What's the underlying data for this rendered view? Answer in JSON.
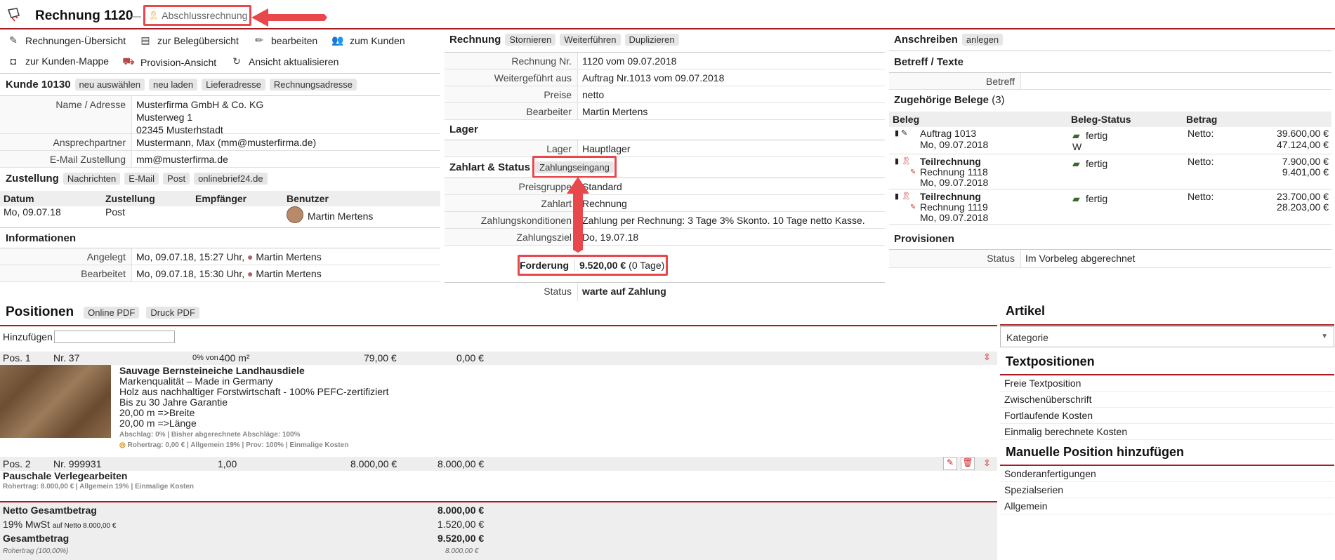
{
  "header": {
    "title": "Rechnung 1120",
    "separator": "—",
    "type_badge": "Abschlussrechnung"
  },
  "toolbar": {
    "items": [
      {
        "label": "Rechnungen-Übersicht",
        "icon": "invoices-icon"
      },
      {
        "label": "zur Belegübersicht",
        "icon": "documents-icon"
      },
      {
        "label": "bearbeiten",
        "icon": "pencil-icon"
      },
      {
        "label": "zum Kunden",
        "icon": "users-icon"
      },
      {
        "label": "zur Kunden-Mappe",
        "icon": "folder-icon"
      },
      {
        "label": "Provision-Ansicht",
        "icon": "truck-icon"
      },
      {
        "label": "Ansicht aktualisieren",
        "icon": "refresh-icon"
      }
    ]
  },
  "customer": {
    "title": "Kunde 10130",
    "actions": [
      "neu auswählen",
      "neu laden",
      "Lieferadresse",
      "Rechnungsadresse"
    ],
    "rows": [
      {
        "label": "Name / Adresse",
        "lines": [
          "Musterfirma GmbH & Co. KG",
          "Musterweg 1",
          "02345 Musterhstadt"
        ]
      },
      {
        "label": "Ansprechpartner",
        "lines": [
          "Mustermann, Max (mm@musterfirma.de)"
        ]
      },
      {
        "label": "E-Mail Zustellung",
        "lines": [
          "mm@musterfirma.de"
        ]
      }
    ]
  },
  "delivery": {
    "title": "Zustellung",
    "actions": [
      "Nachrichten",
      "E-Mail",
      "Post",
      "onlinebrief24.de"
    ],
    "columns": [
      "Datum",
      "Zustellung",
      "Empfänger",
      "Benutzer"
    ],
    "rows": [
      {
        "datum": "Mo, 09.07.18",
        "zustellung": "Post",
        "empfaenger": "",
        "benutzer": "Martin Mertens"
      }
    ]
  },
  "info": {
    "title": "Informationen",
    "rows": [
      {
        "label": "Angelegt",
        "value": "Mo, 09.07.18, 15:27 Uhr,",
        "user": "Martin Mertens"
      },
      {
        "label": "Bearbeitet",
        "value": "Mo, 09.07.18, 15:30 Uhr,",
        "user": "Martin Mertens"
      }
    ]
  },
  "invoice": {
    "title": "Rechnung",
    "actions": [
      "Stornieren",
      "Weiterführen",
      "Duplizieren"
    ],
    "rows": [
      {
        "label": "Rechnung Nr.",
        "value": "1120 vom 09.07.2018"
      },
      {
        "label": "Weitergeführt aus",
        "value": "Auftrag Nr.1013 vom 09.07.2018"
      },
      {
        "label": "Preise",
        "value": "netto"
      },
      {
        "label": "Bearbeiter",
        "value": "Martin Mertens"
      }
    ]
  },
  "warehouse": {
    "title": "Lager",
    "rows": [
      {
        "label": "Lager",
        "value": "Hauptlager"
      }
    ]
  },
  "payment": {
    "title": "Zahlart & Status",
    "action": "Zahlungseingang",
    "rows": [
      {
        "label": "Preisgruppe",
        "value": "Standard"
      },
      {
        "label": "Zahlart",
        "value": "Rechnung"
      },
      {
        "label": "Zahlungskonditionen",
        "value": "Zahlung per Rechnung: 3 Tage 3% Skonto. 10 Tage netto Kasse."
      },
      {
        "label": "Zahlungsziel",
        "value": "Do, 19.07.18"
      }
    ],
    "claim_label": "Forderung",
    "claim_value": "9.520,00 €",
    "claim_days": "(0 Tage)",
    "status_label": "Status",
    "status_value": "warte auf Zahlung"
  },
  "letter": {
    "title": "Anschreiben",
    "action": "anlegen",
    "subject_title": "Betreff / Texte",
    "subject_label": "Betreff"
  },
  "related": {
    "title": "Zugehörige Belege",
    "count": "(3)",
    "columns": [
      "Beleg",
      "Beleg-Status",
      "Betrag"
    ],
    "rows": [
      {
        "name": "Auftrag 1013",
        "bold": false,
        "sub": "",
        "date": "Mo, 09.07.2018",
        "status": "fertig",
        "status2": "W",
        "betrag_label": "Netto:",
        "netto": "39.600,00 €",
        "brutto": "47.124,00 €"
      },
      {
        "name": "Teilrechnung",
        "bold": true,
        "sub": "Rechnung 1118",
        "date": "Mo, 09.07.2018",
        "status": "fertig",
        "status2": "",
        "betrag_label": "Netto:",
        "netto": "7.900,00 €",
        "brutto": "9.401,00 €"
      },
      {
        "name": "Teilrechnung",
        "bold": true,
        "sub": "Rechnung 1119",
        "date": "Mo, 09.07.2018",
        "status": "fertig",
        "status2": "",
        "betrag_label": "Netto:",
        "netto": "23.700,00 €",
        "brutto": "28.203,00 €"
      }
    ]
  },
  "provisions": {
    "title": "Provisionen",
    "label": "Status",
    "value": "Im Vorbeleg abgerechnet"
  },
  "positions": {
    "title": "Positionen",
    "actions": [
      "Online PDF",
      "Druck PDF"
    ],
    "add_label": "Hinzufügen",
    "add_value": "",
    "items": [
      {
        "pos": "Pos. 1",
        "nr": "Nr. 37",
        "pct": "0% von",
        "qty": "400 m²",
        "price": "79,00 €",
        "total": "0,00 €",
        "name": "Sauvage Bernsteineiche Landhausdiele",
        "desc": [
          "Markenqualität – Made in Germany",
          "Holz aus nachhaltiger Forstwirtschaft - 100% PEFC-zertifiziert",
          "Bis zu 30 Jahre Garantie",
          "20,00 m =>Breite",
          "20,00 m =>Länge"
        ],
        "note1": "Abschlag: 0% | Bisher abgerechnete Abschläge: 100%",
        "note2": "Rohertrag: 0,00 € | Allgemein 19% | Prov: 100% | Einmalige Kosten"
      },
      {
        "pos": "Pos. 2",
        "nr": "Nr. 999931",
        "qty": "1,00",
        "price": "8.000,00 €",
        "total": "8.000,00 €",
        "name": "Pauschale Verlegearbeiten",
        "note2": "Rohertrag: 8.000,00 € | Allgemein 19% | Einmalige Kosten"
      }
    ],
    "totals": {
      "net_label": "Netto Gesamtbetrag",
      "net": "8.000,00 €",
      "tax_label": "19% MwSt",
      "tax_sub": "auf Netto 8.000,00 €",
      "tax": "1.520,00 €",
      "gross_label": "Gesamtbetrag",
      "gross": "9.520,00 €",
      "margin_label": "Rohertrag (100,00%)",
      "margin": "8.000,00 €"
    }
  },
  "articles": {
    "title": "Artikel",
    "category_placeholder": "Kategorie",
    "text_title": "Textpositionen",
    "text_items": [
      "Freie Textposition",
      "Zwischenüberschrift",
      "Fortlaufende Kosten",
      "Einmalig berechnete Kosten"
    ],
    "manual_title": "Manuelle Position hinzufügen",
    "manual_items": [
      "Sonderanfertigungen",
      "Spezialserien",
      "Allgemein"
    ]
  }
}
